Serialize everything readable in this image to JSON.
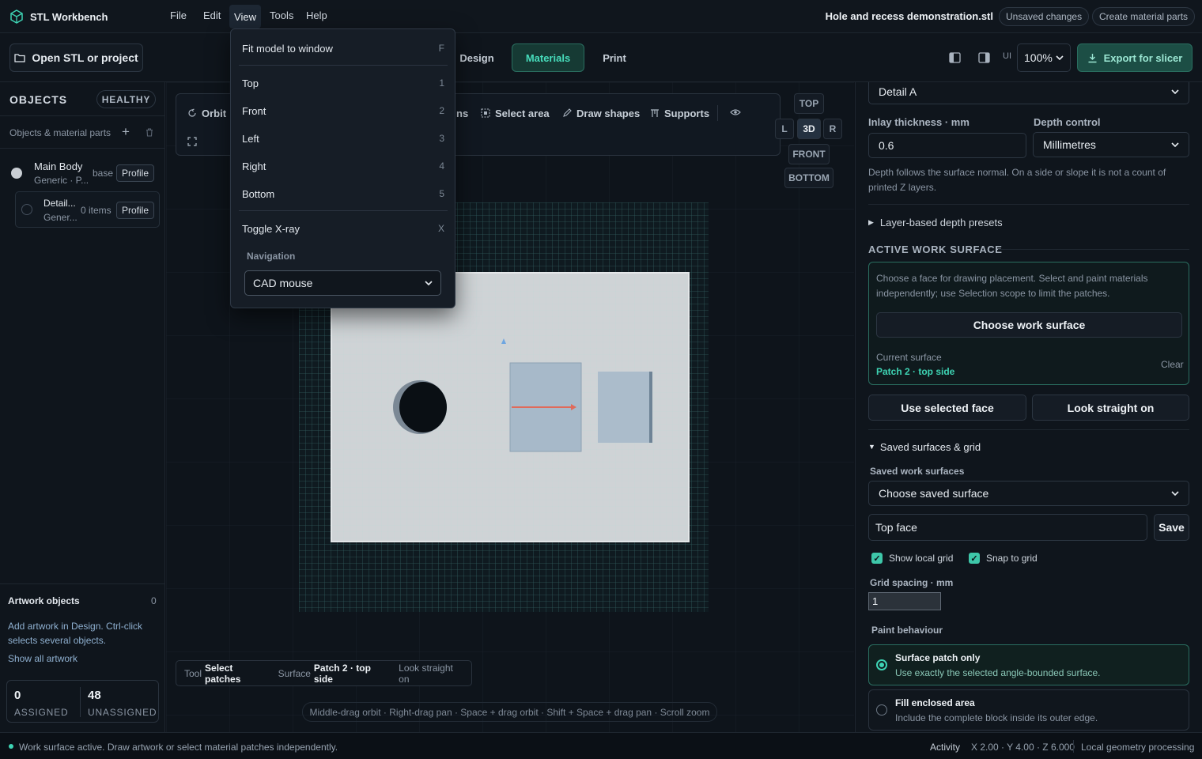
{
  "app": {
    "name": "STL Workbench",
    "menus": [
      "File",
      "Edit",
      "View",
      "Tools",
      "Help"
    ],
    "filename": "Hole and recess demonstration.stl",
    "unsaved_label": "Unsaved changes",
    "create_parts_label": "Create material parts"
  },
  "toolbar": {
    "open_label": "Open STL or project",
    "tabs": [
      "Design",
      "Materials",
      "Print"
    ],
    "active_tab": "Materials",
    "ui_label": "UI",
    "zoom": "100%",
    "export_label": "Export for slicer"
  },
  "view_menu": {
    "items": [
      {
        "label": "Fit model to window",
        "key": "F"
      },
      {
        "label": "Top",
        "key": "1"
      },
      {
        "label": "Front",
        "key": "2"
      },
      {
        "label": "Left",
        "key": "3"
      },
      {
        "label": "Right",
        "key": "4"
      },
      {
        "label": "Bottom",
        "key": "5"
      },
      {
        "label": "Toggle X-ray",
        "key": "X"
      }
    ],
    "navigation_label": "Navigation",
    "navigation_value": "CAD mouse"
  },
  "sidebar": {
    "title": "OBJECTS",
    "health_badge": "HEALTHY",
    "parts_label": "Objects & material parts",
    "objects": [
      {
        "name": "Main Body",
        "sub": "Generic · P...",
        "tag": "base",
        "action": "Profile"
      },
      {
        "name": "Detail...",
        "sub": "Gener...",
        "tag": "0 items",
        "action": "Profile"
      }
    ],
    "artwork_title": "Artwork objects",
    "artwork_count": "0",
    "artwork_help": "Add artwork in Design. Ctrl-click selects several objects.",
    "show_all_label": "Show all artwork",
    "assigned_value": "0",
    "assigned_label": "ASSIGNED",
    "unassigned_value": "48",
    "unassigned_label": "UNASSIGNED"
  },
  "viewport": {
    "tools": [
      "Orbit",
      "ns",
      "Select area",
      "Draw shapes",
      "Supports"
    ],
    "view_buttons": {
      "top": "TOP",
      "left": "L",
      "threeD": "3D",
      "right": "R",
      "front": "FRONT",
      "bottom": "BOTTOM"
    },
    "status": {
      "tool_prefix": "Tool",
      "tool_value": "Select patches",
      "surface_prefix": "Surface",
      "surface_value": "Patch 2 · top side",
      "action": "Look straight on"
    },
    "hint": "Middle-drag orbit · Right-drag pan · Space + drag orbit · Shift + Space + drag pan · Scroll zoom"
  },
  "right_panel": {
    "part_select": "Detail A",
    "inlay_label": "Inlay thickness · mm",
    "inlay_value": "0.6",
    "depth_label": "Depth control",
    "depth_value": "Millimetres",
    "depth_help": "Depth follows the surface normal. On a side or slope it is not a count of printed Z layers.",
    "presets_label": "Layer-based depth presets",
    "active_surface_title": "ACTIVE WORK SURFACE",
    "surface_help": "Choose a face for drawing placement. Select and paint materials independently; use Selection scope to limit the patches.",
    "choose_surface_label": "Choose work surface",
    "current_surface_label": "Current surface",
    "current_surface_value": "Patch 2 · top side",
    "clear_label": "Clear",
    "use_face_label": "Use selected face",
    "look_label": "Look straight on",
    "saved_section_label": "Saved surfaces & grid",
    "saved_surfaces_label": "Saved work surfaces",
    "saved_select": "Choose saved surface",
    "name_value": "Top face",
    "save_label": "Save",
    "show_grid_label": "Show local grid",
    "snap_label": "Snap to grid",
    "grid_spacing_label": "Grid spacing · mm",
    "grid_spacing_value": "1",
    "paint_label": "Paint behaviour",
    "paint_options": [
      {
        "title": "Surface patch only",
        "desc": "Use exactly the selected angle-bounded surface.",
        "selected": true
      },
      {
        "title": "Fill enclosed area",
        "desc": "Include the complete block inside its outer edge.",
        "selected": false
      }
    ]
  },
  "statusbar": {
    "message": "Work surface active. Draw artwork or select material patches independently.",
    "activity": "Activity",
    "coords": "X 2.00 · Y 4.00 · Z 6.000",
    "processing": "Local geometry processing"
  },
  "colors": {
    "accent": "#3ed4b4",
    "background": "#0d1219",
    "panel": "#0f151c"
  }
}
